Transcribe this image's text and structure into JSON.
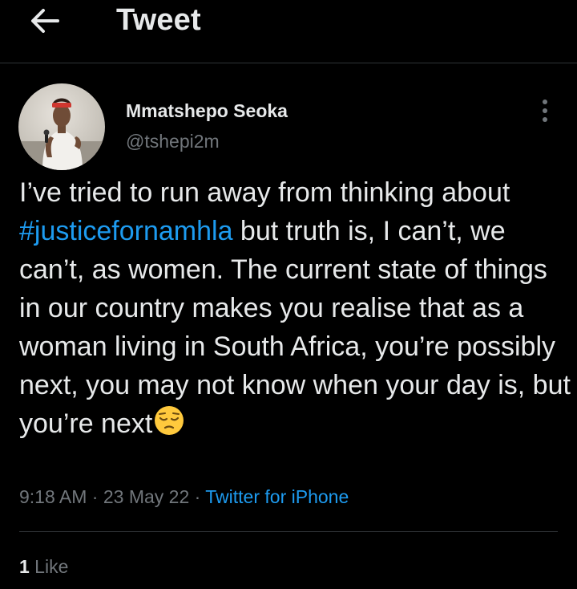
{
  "header": {
    "title": "Tweet",
    "back_icon": "arrow-left-icon"
  },
  "author": {
    "display_name": "Mmatshepo Seoka",
    "handle": "@tshepi2m"
  },
  "tweet": {
    "text_part1": "I’ve tried to run away from thinking about ",
    "hashtag": "#justicefornamhla",
    "text_part2": " but truth is, I can’t, we can’t, as women. The current state of things in our country makes you realise that as a woman living in South Africa, you’re possibly next, you may not know when your day is, but you’re next",
    "emoji": "pensive-face-icon"
  },
  "meta": {
    "time": "9:18 AM",
    "separator1": " · ",
    "date": "23 May 22",
    "separator2": " · ",
    "source": "Twitter for iPhone"
  },
  "stats": {
    "likes_count": "1",
    "likes_label": " Like"
  },
  "colors": {
    "background": "#000000",
    "text": "#e7e9ea",
    "secondary": "#71767b",
    "accent": "#1d9bf0",
    "divider": "#2f3336"
  }
}
